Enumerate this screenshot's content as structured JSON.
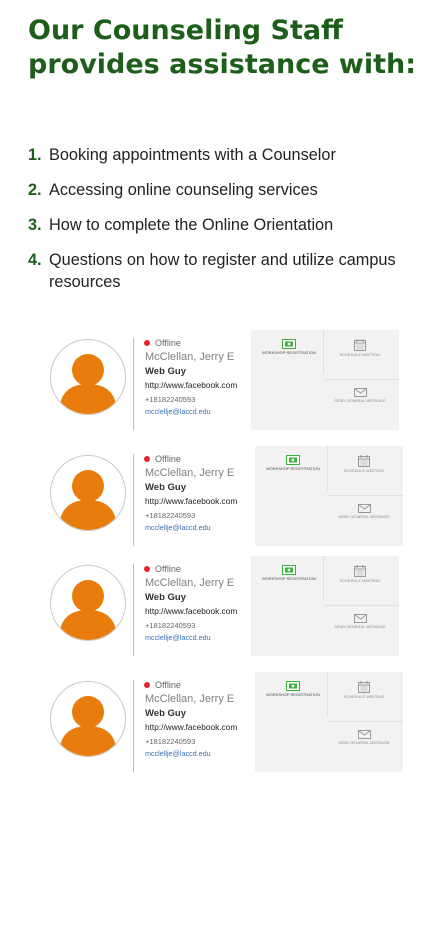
{
  "heading": "Our Counseling Staff provides assistance with:",
  "assistance": [
    {
      "num": "1.",
      "text": "Booking appointments with a Counselor"
    },
    {
      "num": "2.",
      "text": "Accessing online counseling services"
    },
    {
      "num": "3.",
      "text": "How to complete the Online Orientation"
    },
    {
      "num": "4.",
      "text": "Questions on how to register and utilize campus resources"
    }
  ],
  "counselors": [
    {
      "status": "Offline",
      "name": "McClellan, Jerry E",
      "role": "Web Guy",
      "url": "http://www.facebook.com",
      "phone": "+18182240593",
      "email": "mcclellje@laccd.edu"
    },
    {
      "status": "Offline",
      "name": "McClellan, Jerry E",
      "role": "Web Guy",
      "url": "http://www.facebook.com",
      "phone": "+18182240593",
      "email": "mcclellje@laccd.edu"
    },
    {
      "status": "Offline",
      "name": "McClellan, Jerry E",
      "role": "Web Guy",
      "url": "http://www.facebook.com",
      "phone": "+18182240593",
      "email": "mcclellje@laccd.edu"
    },
    {
      "status": "Offline",
      "name": "McClellan, Jerry E",
      "role": "Web Guy",
      "url": "http://www.facebook.com",
      "phone": "+18182240593",
      "email": "mcclellje@laccd.edu"
    }
  ],
  "actions": {
    "workshop_label": "WORKSHOP REGISTRATION",
    "schedule_label": "SCHEDULE MEETING",
    "email_label": "SEND GENERAL MESSAGE"
  },
  "colors": {
    "heading": "#1d5e1a",
    "accent_green": "#3bb03b",
    "status_offline": "#e8262a",
    "avatar_orange": "#e87c0c",
    "panel_bg": "#f2f2f2",
    "email_link": "#3a6fb5"
  },
  "icons": {
    "workshop": "workshop-registration-icon",
    "schedule": "calendar-icon",
    "email": "envelope-icon",
    "status": "status-dot-icon",
    "avatar": "user-avatar-icon"
  }
}
